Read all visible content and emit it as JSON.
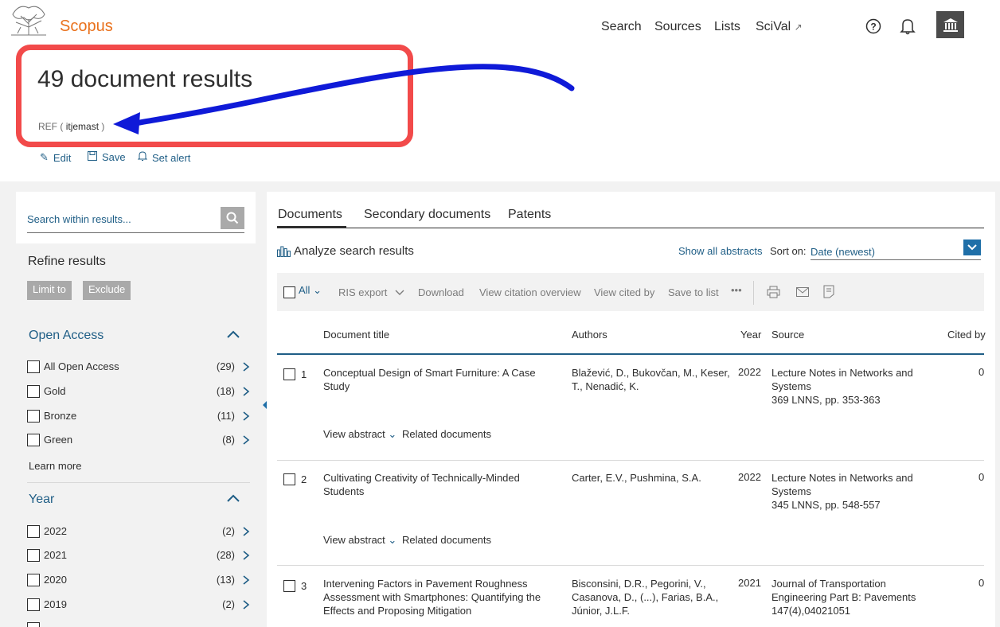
{
  "header": {
    "brand": "Scopus",
    "nav": {
      "search": "Search",
      "sources": "Sources",
      "lists": "Lists",
      "scival": "SciVal",
      "scival_icon": "external-arrow"
    },
    "icons": [
      "help-icon",
      "bell-icon",
      "institution-icon"
    ]
  },
  "results": {
    "title": "49 document results",
    "query_field": "REF (",
    "query_term": "itjemast",
    "query_close": ")",
    "actions": {
      "edit": "Edit",
      "save": "Save",
      "set_alert": "Set alert"
    }
  },
  "annotation": {
    "box_color": "#f24a4a",
    "arrow_color": "#0f1ad8"
  },
  "sidebar": {
    "search_placeholder": "Search within results...",
    "refine_title": "Refine results",
    "limit_to": "Limit to",
    "exclude": "Exclude",
    "open_access": {
      "title": "Open Access",
      "items": [
        {
          "label": "All Open Access",
          "count": "(29)"
        },
        {
          "label": "Gold",
          "count": "(18)"
        },
        {
          "label": "Bronze",
          "count": "(11)"
        },
        {
          "label": "Green",
          "count": "(8)"
        }
      ],
      "learn_more": "Learn more"
    },
    "year": {
      "title": "Year",
      "items": [
        {
          "label": "2022",
          "count": "(2)"
        },
        {
          "label": "2021",
          "count": "(28)"
        },
        {
          "label": "2020",
          "count": "(13)"
        },
        {
          "label": "2019",
          "count": "(2)"
        }
      ]
    }
  },
  "main": {
    "tabs": [
      "Documents",
      "Secondary documents",
      "Patents"
    ],
    "analyze": "Analyze search results",
    "show_all_abstracts": "Show all abstracts",
    "sort_label": "Sort on:",
    "sort_value": "Date (newest)",
    "toolbar": {
      "all": "All",
      "ris_export": "RIS export",
      "download": "Download",
      "view_citation_overview": "View citation overview",
      "view_cited_by": "View cited by",
      "save_to_list": "Save to list",
      "more": "•••"
    },
    "columns": {
      "title": "Document title",
      "authors": "Authors",
      "year": "Year",
      "source": "Source",
      "cited_by": "Cited by"
    },
    "view_abstract": "View abstract",
    "related_documents": "Related documents",
    "rows": [
      {
        "num": "1",
        "title": "Conceptual Design of Smart Furniture: A Case Study",
        "authors": "Blažević, D., Bukovčan, M., Keser, T., Nenadić, K.",
        "year": "2022",
        "source": "Lecture Notes in Networks and Systems",
        "source_detail": "369 LNNS, pp. 353-363",
        "cited": "0"
      },
      {
        "num": "2",
        "title": "Cultivating Creativity of Technically-Minded Students",
        "authors": "Carter, E.V., Pushmina, S.A.",
        "year": "2022",
        "source": "Lecture Notes in Networks and Systems",
        "source_detail": "345 LNNS, pp. 548-557",
        "cited": "0"
      },
      {
        "num": "3",
        "title": "Intervening Factors in Pavement Roughness Assessment with Smartphones: Quantifying the Effects and Proposing Mitigation",
        "authors": "Bisconsini, D.R., Pegorini, V., Casanova, D., (...), Farias, B.A., Júnior, J.L.F.",
        "year": "2021",
        "source": "Journal of Transportation Engineering Part B: Pavements",
        "source_detail": "147(4),04021051",
        "cited": "0"
      }
    ]
  }
}
